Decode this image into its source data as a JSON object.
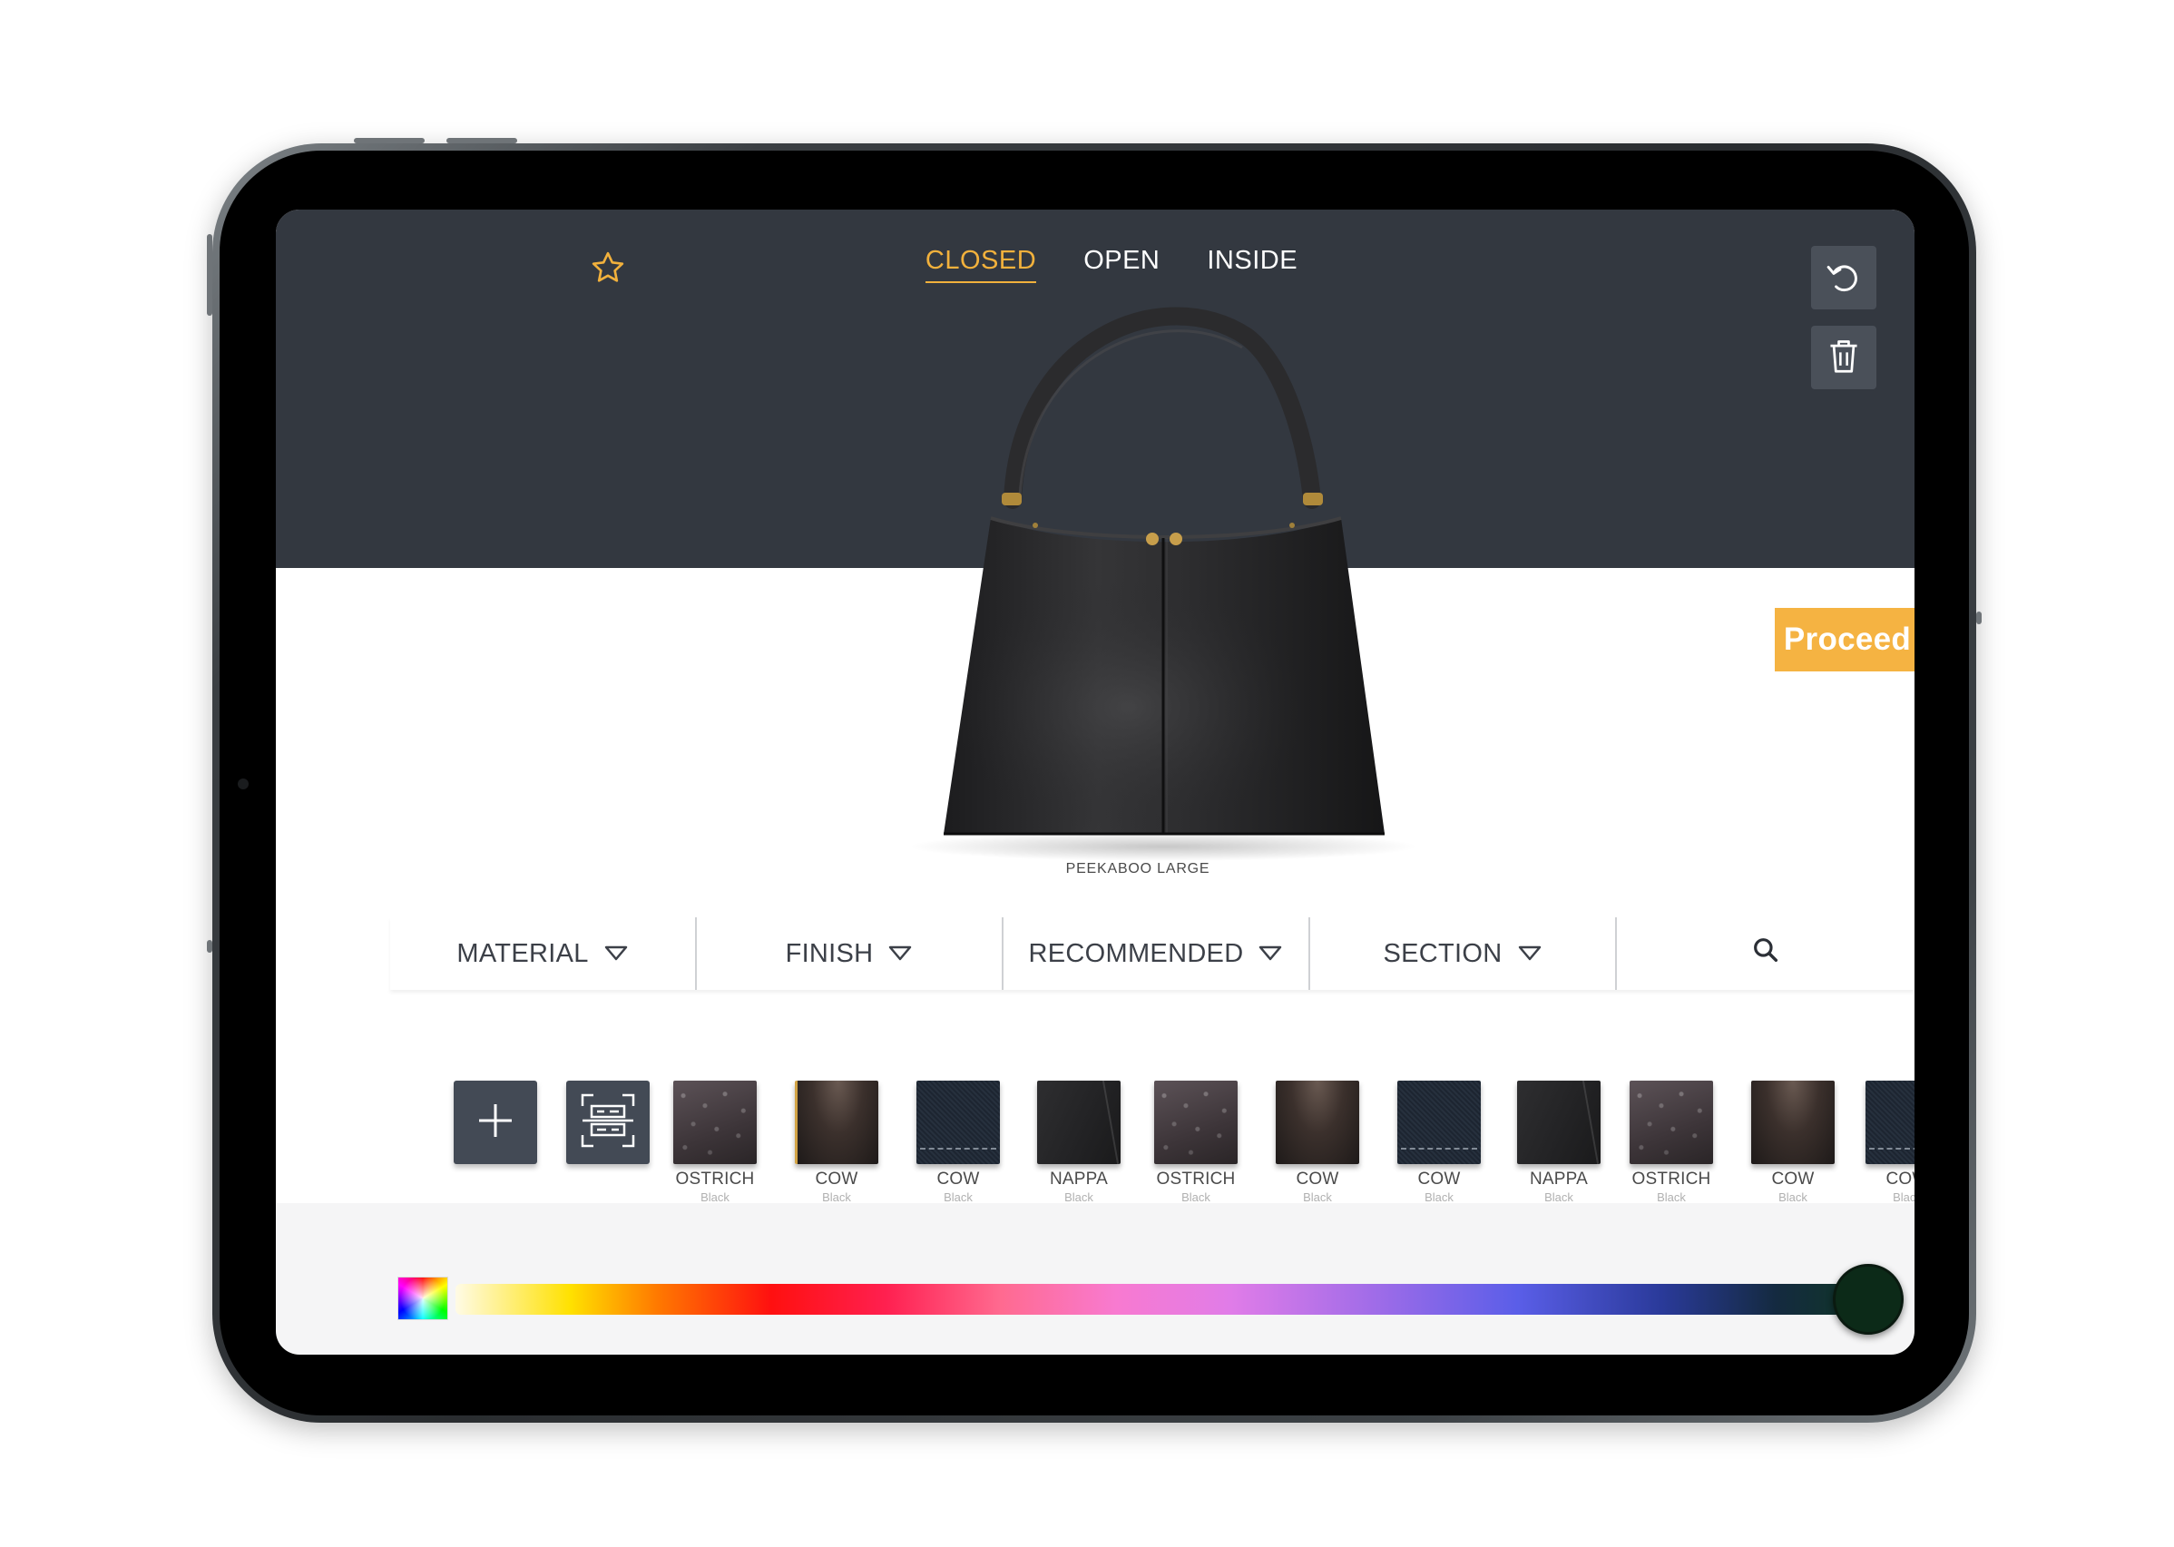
{
  "view_tabs": [
    {
      "label": "CLOSED",
      "active": true
    },
    {
      "label": "OPEN",
      "active": false
    },
    {
      "label": "INSIDE",
      "active": false
    }
  ],
  "proceed_label": "Proceed",
  "product_name": "PEEKABOO LARGE",
  "filters": [
    {
      "label": "MATERIAL",
      "icon": "chevron-down-icon"
    },
    {
      "label": "FINISH",
      "icon": "chevron-down-icon"
    },
    {
      "label": "RECOMMENDED",
      "icon": "chevron-down-icon"
    },
    {
      "label": "SECTION",
      "icon": "chevron-down-icon"
    },
    {
      "label": "",
      "icon": "search-icon"
    }
  ],
  "actions": [
    {
      "icon": "plus-icon"
    },
    {
      "icon": "qr-scan-icon"
    }
  ],
  "swatches": [
    {
      "name": "OSTRICH",
      "color": "Black",
      "texture": "ostrich"
    },
    {
      "name": "COW",
      "color": "Black",
      "texture": "cow"
    },
    {
      "name": "COW",
      "color": "Black",
      "texture": "navy"
    },
    {
      "name": "NAPPA",
      "color": "Black",
      "texture": "nappa"
    },
    {
      "name": "OSTRICH",
      "color": "Black",
      "texture": "ostrich"
    },
    {
      "name": "COW",
      "color": "Black",
      "texture": "cow"
    },
    {
      "name": "COW",
      "color": "Black",
      "texture": "navy"
    },
    {
      "name": "NAPPA",
      "color": "Black",
      "texture": "nappa"
    },
    {
      "name": "OSTRICH",
      "color": "Black",
      "texture": "ostrich"
    },
    {
      "name": "COW",
      "color": "Black",
      "texture": "cow"
    },
    {
      "name": "COW",
      "color": "Black",
      "texture": "navy"
    }
  ],
  "colors": {
    "accent": "#f2b13c",
    "proceed": "#f5b342",
    "header_bg": "#333840",
    "tool_bg": "#4a5059",
    "selected_color": "#0c2a18"
  },
  "color_slider": {
    "value": 1.0
  }
}
